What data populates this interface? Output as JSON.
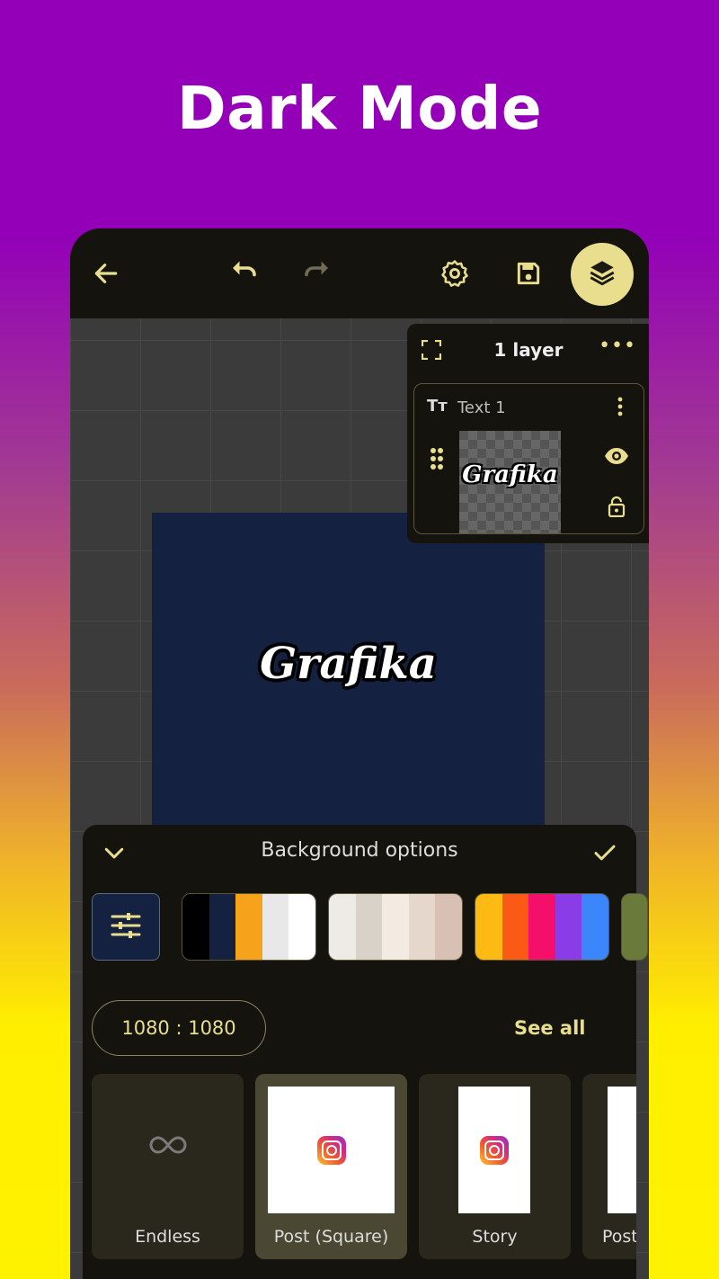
{
  "headline": "Dark Mode",
  "toolbar": {
    "icons": [
      "back-arrow-icon",
      "undo-icon",
      "redo-icon",
      "settings-icon",
      "save-icon",
      "layers-icon"
    ],
    "accent": "#e9de8e"
  },
  "canvas": {
    "artboard_color": "#152141",
    "artboard_text": "Grafika"
  },
  "layers_panel": {
    "title": "1 layer",
    "more": "•••",
    "layers": [
      {
        "name": "Text 1",
        "type_icon": "Tт",
        "thumbnail_text": "Grafika"
      }
    ]
  },
  "background_sheet": {
    "title": "Background options",
    "ratio": "1080 : 1080",
    "see_all": "See all",
    "palettes": [
      [
        "#000000",
        "#152141",
        "#f7a21b",
        "#e8e8e8",
        "#ffffff"
      ],
      [
        "#ecebe6",
        "#d9d2c8",
        "#f3ebe1",
        "#e6d7cc",
        "#d9c0b4"
      ],
      [
        "#fdba12",
        "#fb5a16",
        "#f40f6a",
        "#8a3de6",
        "#3a86fa"
      ]
    ],
    "presets": [
      {
        "label": "Endless",
        "icon": "infinity-icon"
      },
      {
        "label": "Post (Square)",
        "icon": "instagram-icon"
      },
      {
        "label": "Story",
        "icon": "instagram-icon"
      },
      {
        "label": "Post",
        "icon": "instagram-icon"
      }
    ]
  }
}
